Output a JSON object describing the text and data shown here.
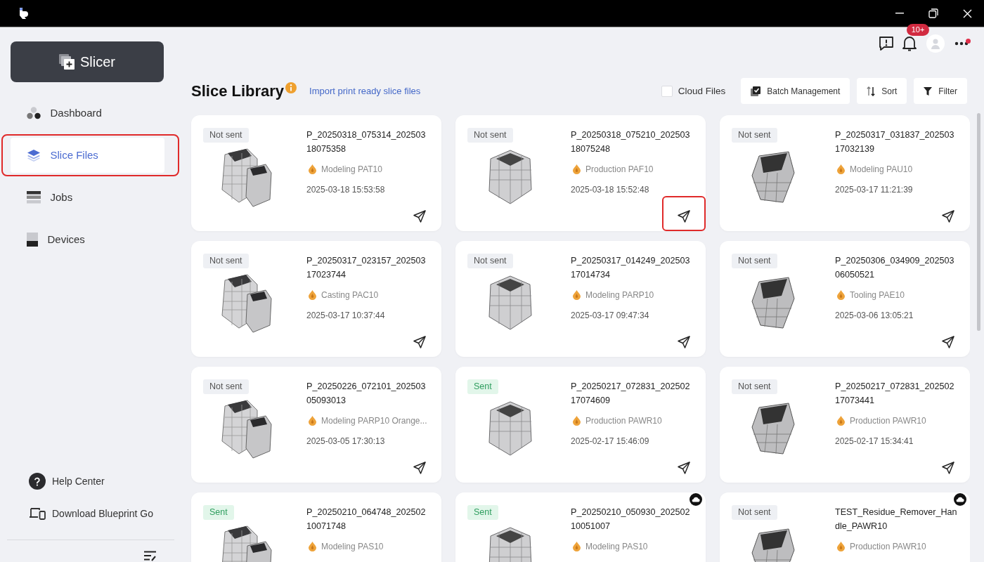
{
  "sidebar": {
    "app_button": "Slicer",
    "items": [
      {
        "label": "Dashboard",
        "kind": "dashboard",
        "selected": false,
        "highlighted": false
      },
      {
        "label": "Slice Files",
        "kind": "slices",
        "selected": true,
        "highlighted": true
      },
      {
        "label": "Jobs",
        "kind": "jobs",
        "selected": false,
        "highlighted": false
      },
      {
        "label": "Devices",
        "kind": "devices",
        "selected": false,
        "highlighted": false
      }
    ],
    "footer_links": [
      {
        "label": "Help Center",
        "kind": "help"
      },
      {
        "label": "Download Blueprint Go",
        "kind": "download"
      }
    ]
  },
  "header": {
    "notification_badge": "10+",
    "menu_alert": true
  },
  "library": {
    "title": "Slice Library",
    "link": "Import print ready slice files",
    "cloud_files": {
      "label": "Cloud Files",
      "checked": false
    },
    "buttons": [
      {
        "label": "Batch Management",
        "kind": "batch"
      },
      {
        "label": "Sort",
        "kind": "sort"
      },
      {
        "label": "Filter",
        "kind": "filter"
      }
    ]
  },
  "cards": [
    {
      "status": "Not sent",
      "sent": false,
      "name": "P_20250318_075314_20250318075358",
      "material": "Modeling PAT10",
      "date": "2025-03-18 15:53:58",
      "cloud": false,
      "send_highlighted": false
    },
    {
      "status": "Not sent",
      "sent": false,
      "name": "P_20250318_075210_20250318075248",
      "material": "Production PAF10",
      "date": "2025-03-18 15:52:48",
      "cloud": false,
      "send_highlighted": true
    },
    {
      "status": "Not sent",
      "sent": false,
      "name": "P_20250317_031837_20250317032139",
      "material": "Modeling PAU10",
      "date": "2025-03-17 11:21:39",
      "cloud": false,
      "send_highlighted": false
    },
    {
      "status": "Not sent",
      "sent": false,
      "name": "P_20250317_023157_20250317023744",
      "material": "Casting PAC10",
      "date": "2025-03-17 10:37:44",
      "cloud": false,
      "send_highlighted": false
    },
    {
      "status": "Not sent",
      "sent": false,
      "name": "P_20250317_014249_20250317014734",
      "material": "Modeling PARP10",
      "date": "2025-03-17 09:47:34",
      "cloud": false,
      "send_highlighted": false
    },
    {
      "status": "Not sent",
      "sent": false,
      "name": "P_20250306_034909_20250306050521",
      "material": "Tooling PAE10",
      "date": "2025-03-06 13:05:21",
      "cloud": false,
      "send_highlighted": false
    },
    {
      "status": "Not sent",
      "sent": false,
      "name": "P_20250226_072101_20250305093013",
      "material": "Modeling PARP10 Orange...",
      "date": "2025-03-05 17:30:13",
      "cloud": false,
      "send_highlighted": false
    },
    {
      "status": "Sent",
      "sent": true,
      "name": "P_20250217_072831_20250217074609",
      "material": "Production PAWR10",
      "date": "2025-02-17 15:46:09",
      "cloud": false,
      "send_highlighted": false
    },
    {
      "status": "Not sent",
      "sent": false,
      "name": "P_20250217_072831_20250217073441",
      "material": "Production PAWR10",
      "date": "2025-02-17 15:34:41",
      "cloud": false,
      "send_highlighted": false
    },
    {
      "status": "Sent",
      "sent": true,
      "name": "P_20250210_064748_20250210071748",
      "material": "Modeling PAS10",
      "cloud": false,
      "send_highlighted": false
    },
    {
      "status": "Sent",
      "sent": true,
      "name": "P_20250210_050930_20250210051007",
      "material": "Modeling PAS10",
      "cloud": true,
      "send_highlighted": false
    },
    {
      "status": "Not sent",
      "sent": false,
      "name": "TEST_Residue_Remover_Handle_PAWR10",
      "material": "Production PAWR10",
      "cloud": true,
      "send_highlighted": false
    }
  ]
}
